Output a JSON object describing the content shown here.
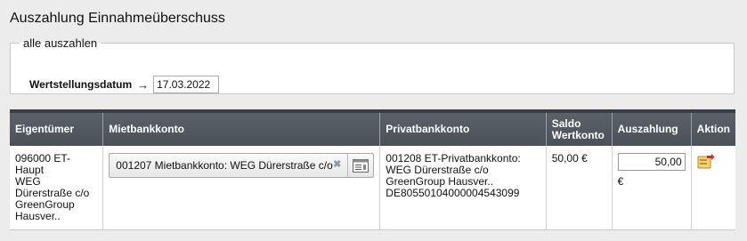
{
  "page": {
    "title": "Auszahlung Einnahmeüberschuss"
  },
  "fieldset": {
    "legend": "alle auszahlen",
    "date_label": "Wertstellungsdatum",
    "date_value": "17.03.2022"
  },
  "table": {
    "headers": {
      "owner": "Eigentümer",
      "rent_account": "Mietbankkonto",
      "private_account": "Privatbankkonto",
      "balance": "Saldo\nWertkonto",
      "payout": "Auszahlung",
      "action": "Aktion"
    },
    "rows": [
      {
        "owner": "096000 ET-Haupt\nWEG\nDürerstraße c/o\nGreenGroup\nHausver..",
        "rent_account": "001207 Mietbankkonto: WEG Dürerstraße c/o",
        "private_account": "001208 ET-Privatbankkonto:\nWEG Dürerstraße c/o\nGreenGroup Hausver..\nDE80550104000004543099",
        "balance": "50,00 €",
        "payout_value": "50,00",
        "currency": "€"
      }
    ]
  },
  "icons": {
    "clear": "close-icon",
    "picker": "list-picker-icon",
    "action": "payout-action-icon"
  }
}
